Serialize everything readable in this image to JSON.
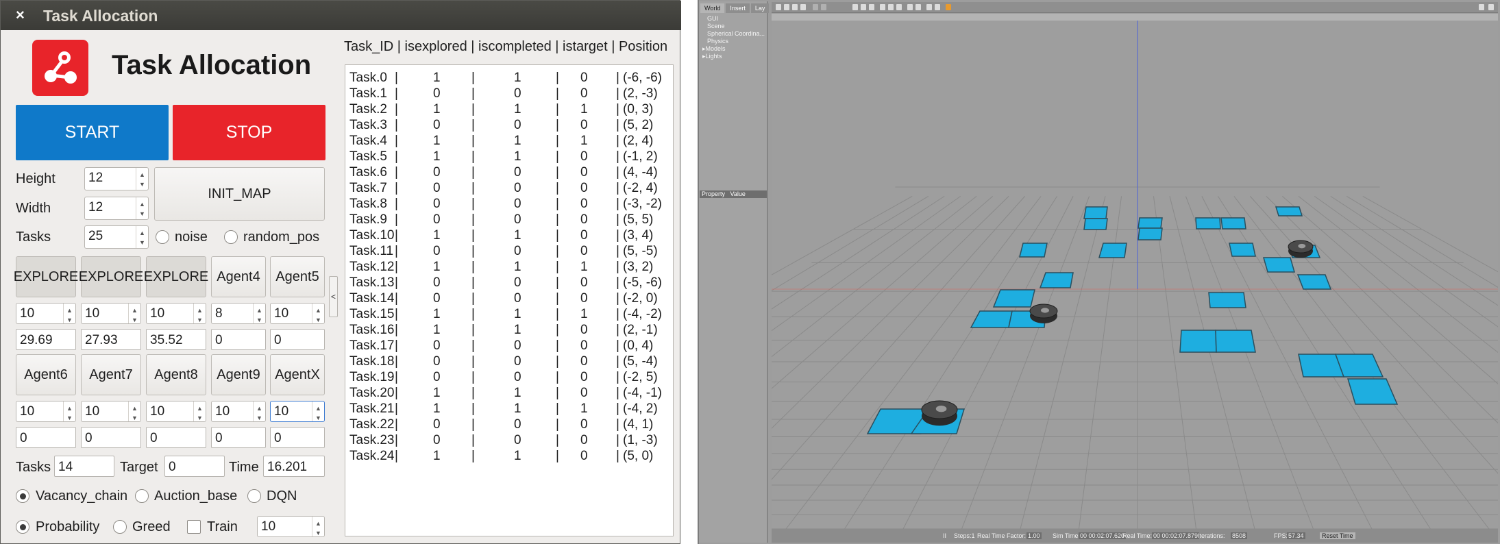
{
  "window": {
    "title": "Task Allocation",
    "close_glyph": "×"
  },
  "app_title": "Task Allocation",
  "controls": {
    "start_label": "START",
    "stop_label": "STOP",
    "height_label": "Height",
    "height_value": "12",
    "width_label": "Width",
    "width_value": "12",
    "tasks_label": "Tasks",
    "tasks_value": "25",
    "init_map_label": "INIT_MAP",
    "noise_label": "noise",
    "random_pos_label": "random_pos"
  },
  "agents_row1": [
    {
      "label": "EXPLORE",
      "spin": "10",
      "value": "29.69"
    },
    {
      "label": "EXPLORE",
      "spin": "10",
      "value": "27.93"
    },
    {
      "label": "EXPLORE",
      "spin": "10",
      "value": "35.52"
    },
    {
      "label": "Agent4",
      "spin": "8",
      "value": "0"
    },
    {
      "label": "Agent5",
      "spin": "10",
      "value": "0"
    }
  ],
  "agents_row2": [
    {
      "label": "Agent6",
      "spin": "10",
      "value": "0"
    },
    {
      "label": "Agent7",
      "spin": "10",
      "value": "0"
    },
    {
      "label": "Agent8",
      "spin": "10",
      "value": "0"
    },
    {
      "label": "Agent9",
      "spin": "10",
      "value": "0"
    },
    {
      "label": "AgentX",
      "spin": "10",
      "value": "0"
    }
  ],
  "summary": {
    "tasks_label": "Tasks",
    "tasks_value": "14",
    "target_label": "Target",
    "target_value": "0",
    "time_label": "Time",
    "time_value": "16.201"
  },
  "algorithms": {
    "vacancy": "Vacancy_chain",
    "auction": "Auction_base",
    "dqn": "DQN"
  },
  "modes": {
    "probability": "Probability",
    "greed": "Greed",
    "train": "Train",
    "train_value": "10"
  },
  "collapse_glyph": "<",
  "table_header": "Task_ID | isexplored | iscompleted | istarget | Position",
  "tasks": [
    {
      "id": "Task.0",
      "explored": "1",
      "completed": "1",
      "target": "0",
      "pos": "(-6, -6)"
    },
    {
      "id": "Task.1",
      "explored": "0",
      "completed": "0",
      "target": "0",
      "pos": "(2, -3)"
    },
    {
      "id": "Task.2",
      "explored": "1",
      "completed": "1",
      "target": "1",
      "pos": "(0, 3)"
    },
    {
      "id": "Task.3",
      "explored": "0",
      "completed": "0",
      "target": "0",
      "pos": "(5, 2)"
    },
    {
      "id": "Task.4",
      "explored": "1",
      "completed": "1",
      "target": "1",
      "pos": "(2, 4)"
    },
    {
      "id": "Task.5",
      "explored": "1",
      "completed": "1",
      "target": "0",
      "pos": "(-1, 2)"
    },
    {
      "id": "Task.6",
      "explored": "0",
      "completed": "0",
      "target": "0",
      "pos": "(4, -4)"
    },
    {
      "id": "Task.7",
      "explored": "0",
      "completed": "0",
      "target": "0",
      "pos": "(-2, 4)"
    },
    {
      "id": "Task.8",
      "explored": "0",
      "completed": "0",
      "target": "0",
      "pos": "(-3, -2)"
    },
    {
      "id": "Task.9",
      "explored": "0",
      "completed": "0",
      "target": "0",
      "pos": "(5, 5)"
    },
    {
      "id": "Task.10",
      "explored": "1",
      "completed": "1",
      "target": "0",
      "pos": "(3, 4)"
    },
    {
      "id": "Task.11",
      "explored": "0",
      "completed": "0",
      "target": "0",
      "pos": "(5, -5)"
    },
    {
      "id": "Task.12",
      "explored": "1",
      "completed": "1",
      "target": "1",
      "pos": "(3, 2)"
    },
    {
      "id": "Task.13",
      "explored": "0",
      "completed": "0",
      "target": "0",
      "pos": "(-5, -6)"
    },
    {
      "id": "Task.14",
      "explored": "0",
      "completed": "0",
      "target": "0",
      "pos": "(-2, 0)"
    },
    {
      "id": "Task.15",
      "explored": "1",
      "completed": "1",
      "target": "1",
      "pos": "(-4, -2)"
    },
    {
      "id": "Task.16",
      "explored": "1",
      "completed": "1",
      "target": "0",
      "pos": "(2, -1)"
    },
    {
      "id": "Task.17",
      "explored": "0",
      "completed": "0",
      "target": "0",
      "pos": "(0, 4)"
    },
    {
      "id": "Task.18",
      "explored": "0",
      "completed": "0",
      "target": "0",
      "pos": "(5, -4)"
    },
    {
      "id": "Task.19",
      "explored": "0",
      "completed": "0",
      "target": "0",
      "pos": "(-2, 5)"
    },
    {
      "id": "Task.20",
      "explored": "1",
      "completed": "1",
      "target": "0",
      "pos": "(-4, -1)"
    },
    {
      "id": "Task.21",
      "explored": "1",
      "completed": "1",
      "target": "1",
      "pos": "(-4, 2)"
    },
    {
      "id": "Task.22",
      "explored": "0",
      "completed": "0",
      "target": "0",
      "pos": "(4, 1)"
    },
    {
      "id": "Task.23",
      "explored": "0",
      "completed": "0",
      "target": "0",
      "pos": "(1, -3)"
    },
    {
      "id": "Task.24",
      "explored": "1",
      "completed": "1",
      "target": "0",
      "pos": "(5, 0)"
    }
  ],
  "gazebo": {
    "tabs": [
      "World",
      "Insert",
      "Lay"
    ],
    "tree": [
      "GUI",
      "Scene",
      "Spherical Coordina...",
      "Physics",
      "Models",
      "Lights"
    ],
    "prop_header": "Property",
    "value_header": "Value",
    "status": {
      "play_glyph": "II",
      "steps": "Steps:1",
      "rtf_label": "Real Time Factor:",
      "rtf_value": "1.00",
      "sim_label": "Sim Time:",
      "sim_value": "00 00:02:07.620",
      "real_label": "Real Time:",
      "real_value": "00 00:02:07.879",
      "iter_label": "Iterations:",
      "iter_value": "8508",
      "fps_label": "FPS:",
      "fps_value": "57.34",
      "reset_label": "Reset Time"
    }
  },
  "colors": {
    "accent_blue": "#0f79c9",
    "accent_red": "#e8242a",
    "tile": "#1eaee0"
  }
}
